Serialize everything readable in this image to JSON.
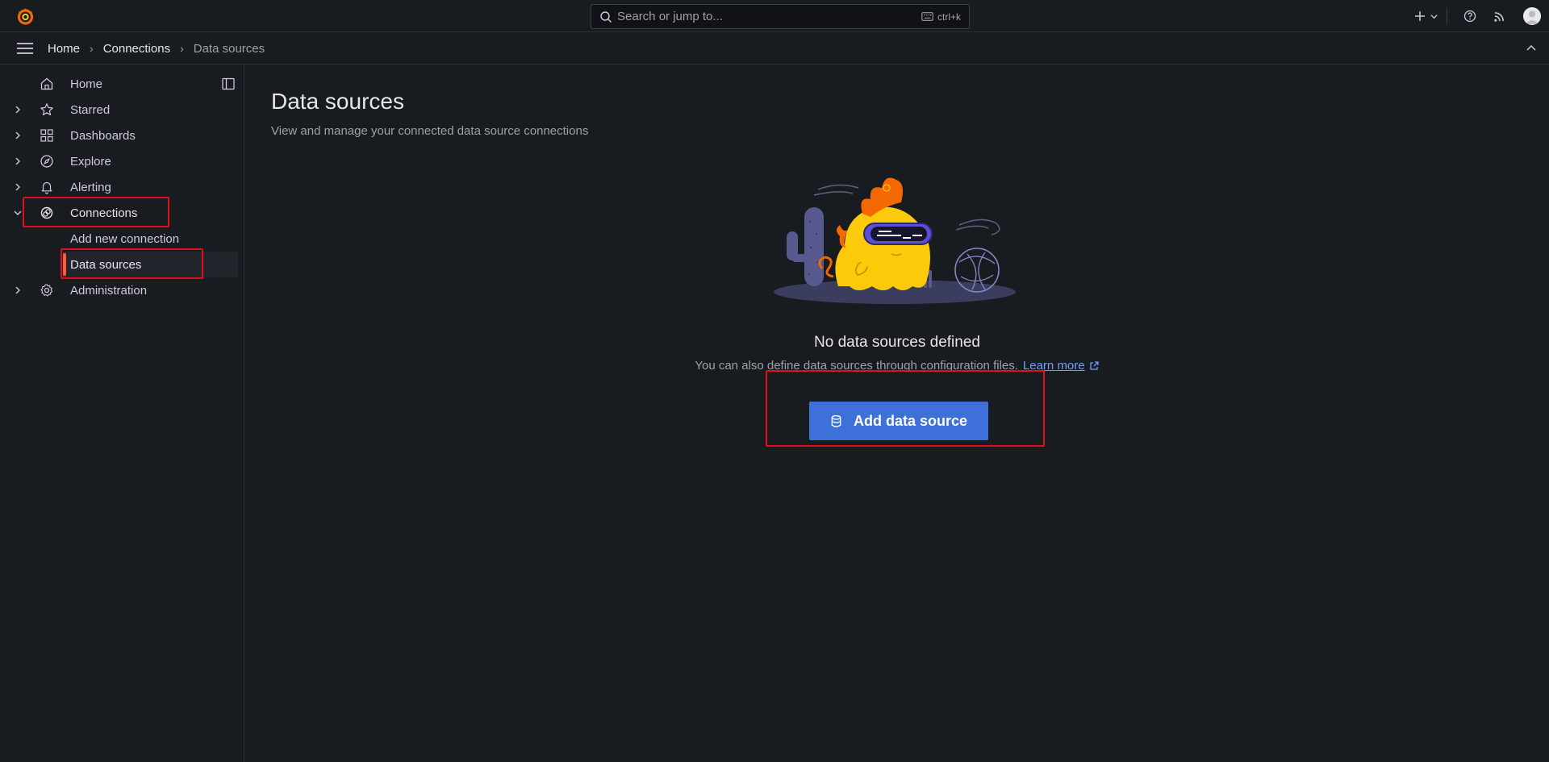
{
  "topbar": {
    "logo_icon": "grafana-logo-icon",
    "search": {
      "placeholder": "Search or jump to...",
      "shortcut": "ctrl+k"
    },
    "icons": [
      "plus-icon",
      "chevron-down-icon",
      "help-icon",
      "rss-icon",
      "user-avatar"
    ]
  },
  "breadcrumb": {
    "items": [
      "Home",
      "Connections"
    ],
    "current": "Data sources",
    "separator": "›"
  },
  "sidebar": {
    "items": [
      {
        "label": "Home",
        "icon": "home-icon",
        "expandable": false
      },
      {
        "label": "Starred",
        "icon": "star-icon",
        "expandable": true
      },
      {
        "label": "Dashboards",
        "icon": "apps-icon",
        "expandable": true
      },
      {
        "label": "Explore",
        "icon": "compass-icon",
        "expandable": true
      },
      {
        "label": "Alerting",
        "icon": "bell-icon",
        "expandable": true
      },
      {
        "label": "Connections",
        "icon": "connections-icon",
        "expandable": true,
        "expanded": true
      },
      {
        "label": "Administration",
        "icon": "gear-icon",
        "expandable": true
      }
    ],
    "connections_children": [
      {
        "label": "Add new connection",
        "selected": false
      },
      {
        "label": "Data sources",
        "selected": true
      }
    ]
  },
  "main": {
    "title": "Data sources",
    "subtitle": "View and manage your connected data source connections",
    "empty_state": {
      "title": "No data sources defined",
      "description": "You can also define data sources through configuration files.",
      "link_label": "Learn more",
      "button_label": "Add data source",
      "button_icon": "database-icon"
    }
  },
  "colors": {
    "background": "#181b1f",
    "primary_button": "#3d71d9",
    "selected_indicator": "#f55f3e",
    "link": "#6e9fff",
    "annotation": "#e0101a"
  }
}
